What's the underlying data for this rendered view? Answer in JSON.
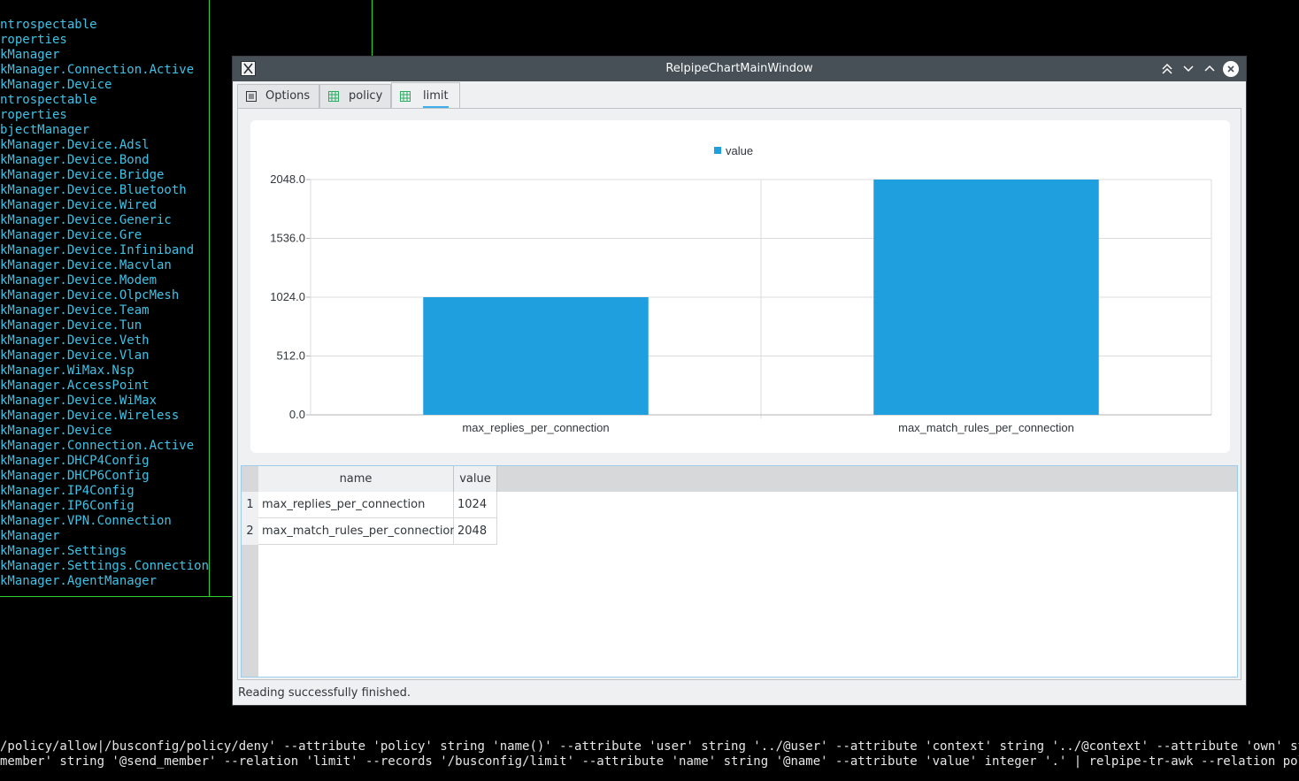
{
  "terminal": {
    "list_lines": [
      "ntrospectable",
      "roperties",
      "kManager",
      "kManager.Connection.Active",
      "kManager.Device",
      "ntrospectable",
      "roperties",
      "bjectManager",
      "kManager.Device.Adsl",
      "kManager.Device.Bond",
      "kManager.Device.Bridge",
      "kManager.Device.Bluetooth",
      "kManager.Device.Wired",
      "kManager.Device.Generic",
      "kManager.Device.Gre",
      "kManager.Device.Infiniband",
      "kManager.Device.Macvlan",
      "kManager.Device.Modem",
      "kManager.Device.OlpcMesh",
      "kManager.Device.Team",
      "kManager.Device.Tun",
      "kManager.Device.Veth",
      "kManager.Device.Vlan",
      "kManager.WiMax.Nsp",
      "kManager.AccessPoint",
      "kManager.Device.WiMax",
      "kManager.Device.Wireless",
      "kManager.Device",
      "kManager.Connection.Active",
      "kManager.DHCP4Config",
      "kManager.DHCP6Config",
      "kManager.IP4Config",
      "kManager.IP6Config",
      "kManager.VPN.Connection",
      "kManager",
      "kManager.Settings",
      "kManager.Settings.Connection",
      "kManager.AgentManager"
    ],
    "command_line_1": "/policy/allow|/busconfig/policy/deny' --attribute 'policy' string 'name()' --attribute 'user' string '../@user' --attribute 'context' string '../@context' --attribute 'own' string '@ow",
    "command_line_2": "member' string '@send_member' --relation 'limit' --records '/busconfig/limit' --attribute 'name' string '@name' --attribute 'value' integer '.' | relpipe-tr-awk --relation policy --whe"
  },
  "window": {
    "title": "RelpipeChartMainWindow",
    "tabs": [
      {
        "label": "Options",
        "icon": "options-icon"
      },
      {
        "label": "policy",
        "icon": "table-icon"
      },
      {
        "label": "limit",
        "icon": "table-icon"
      }
    ],
    "active_tab": "limit",
    "status": "Reading successfully finished."
  },
  "table": {
    "columns": [
      "name",
      "value"
    ],
    "rows": [
      {
        "index": "1",
        "name": "max_replies_per_connection",
        "value": "1024"
      },
      {
        "index": "2",
        "name": "max_match_rules_per_connection",
        "value": "2048"
      }
    ]
  },
  "chart_data": {
    "type": "bar",
    "categories": [
      "max_replies_per_connection",
      "max_match_rules_per_connection"
    ],
    "series": [
      {
        "name": "value",
        "values": [
          1024,
          2048
        ],
        "color": "#209fdf"
      }
    ],
    "ylim": [
      0,
      2048
    ],
    "yticks": [
      "0.0",
      "512.0",
      "1024.0",
      "1536.0",
      "2048.0"
    ],
    "legend": "top-center",
    "grid": true
  },
  "colors": {
    "terminal_text": "#3ec3e8",
    "terminal_border": "#2fd12f",
    "bar": "#209fdf",
    "titlebar": "#475057",
    "accent": "#3daee9"
  }
}
